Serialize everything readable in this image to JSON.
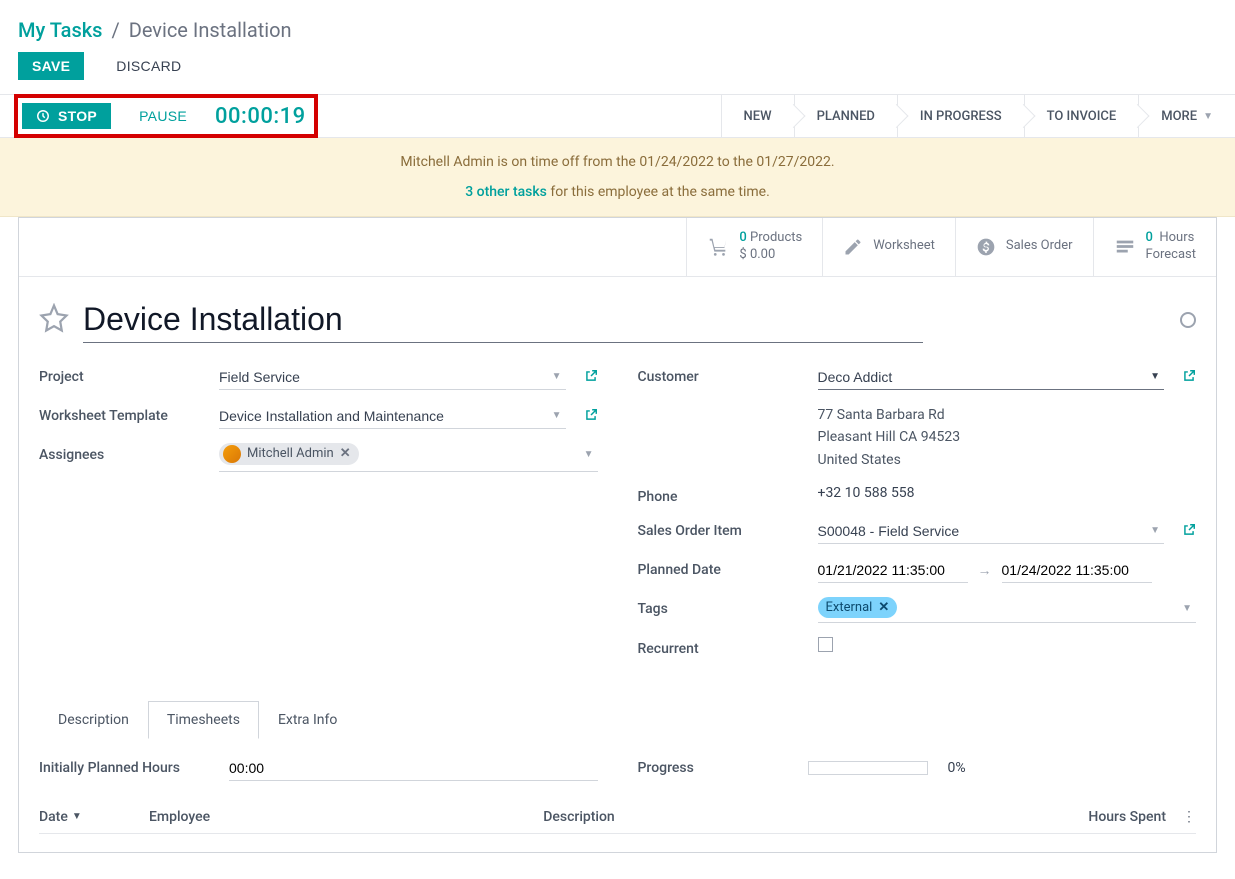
{
  "breadcrumb": {
    "parent": "My Tasks",
    "current": "Device Installation"
  },
  "actions": {
    "save": "SAVE",
    "discard": "DISCARD"
  },
  "timer": {
    "stop": "STOP",
    "pause": "PAUSE",
    "elapsed": "00:00:19"
  },
  "stages": {
    "s1": "NEW",
    "s2": "PLANNED",
    "s3": "IN PROGRESS",
    "s4": "TO INVOICE",
    "more": "MORE"
  },
  "alert": {
    "line1_pre": "Mitchell Admin is on time off from the ",
    "date1": "01/24/2022",
    "line1_mid": " to the ",
    "date2": "01/27/2022.",
    "link": "3 other tasks",
    "line2_rest": " for this employee at the same time."
  },
  "stats": {
    "products_count": "0",
    "products_label": "Products",
    "products_price": "$ 0.00",
    "worksheet": "Worksheet",
    "sales_order": "Sales Order",
    "hours_count": "0",
    "hours_label": "Hours",
    "forecast": "Forecast"
  },
  "title": "Device Installation",
  "labels": {
    "project": "Project",
    "worksheet_template": "Worksheet Template",
    "assignees": "Assignees",
    "customer": "Customer",
    "phone": "Phone",
    "sales_order_item": "Sales Order Item",
    "planned_date": "Planned Date",
    "tags": "Tags",
    "recurrent": "Recurrent"
  },
  "values": {
    "project": "Field Service",
    "worksheet_template": "Device Installation and Maintenance",
    "assignee_name": "Mitchell Admin",
    "customer": "Deco Addict",
    "addr1": "77 Santa Barbara Rd",
    "addr2": "Pleasant Hill CA 94523",
    "addr3": "United States",
    "phone": "+32 10 588 558",
    "sales_order_item": "S00048 - Field Service",
    "date_from": "01/21/2022 11:35:00",
    "date_to": "01/24/2022 11:35:00",
    "tag": "External"
  },
  "tabs": {
    "t1": "Description",
    "t2": "Timesheets",
    "t3": "Extra Info"
  },
  "timesheet": {
    "planned_label": "Initially Planned Hours",
    "planned_value": "00:00",
    "progress_label": "Progress",
    "progress_value": "0%",
    "col_date": "Date",
    "col_employee": "Employee",
    "col_description": "Description",
    "col_hours": "Hours Spent"
  }
}
